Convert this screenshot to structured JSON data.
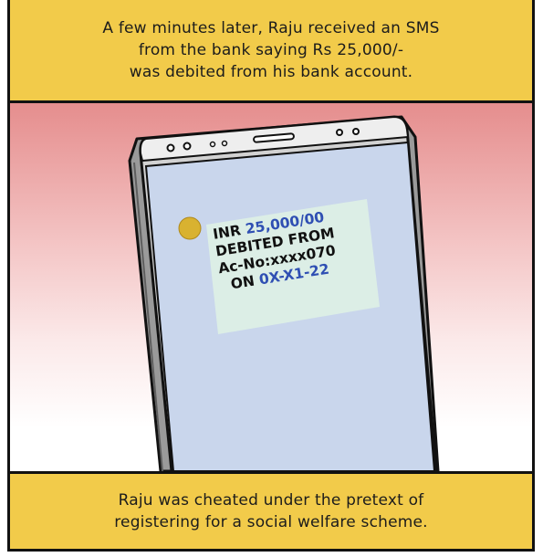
{
  "caption_top": {
    "lines": [
      "A few minutes later, Raju received an SMS",
      "from the bank saying Rs 25,000/-",
      "was debited from his bank account."
    ]
  },
  "sms": {
    "line1_prefix": "INR ",
    "line1_amount": "25,000/00",
    "line2": "DEBITED FROM",
    "line3": "Ac-No:xxxx070",
    "line4_prefix": "ON ",
    "line4_date": "0X-X1-22"
  },
  "caption_bottom": {
    "lines": [
      "Raju was cheated under the pretext of",
      "registering for a social welfare scheme."
    ]
  },
  "colors": {
    "caption_bg": "#f2cb4a",
    "sms_highlight": "#2f4fb3",
    "sms_box": "#dceee6",
    "screen": "#c9d6ec"
  }
}
